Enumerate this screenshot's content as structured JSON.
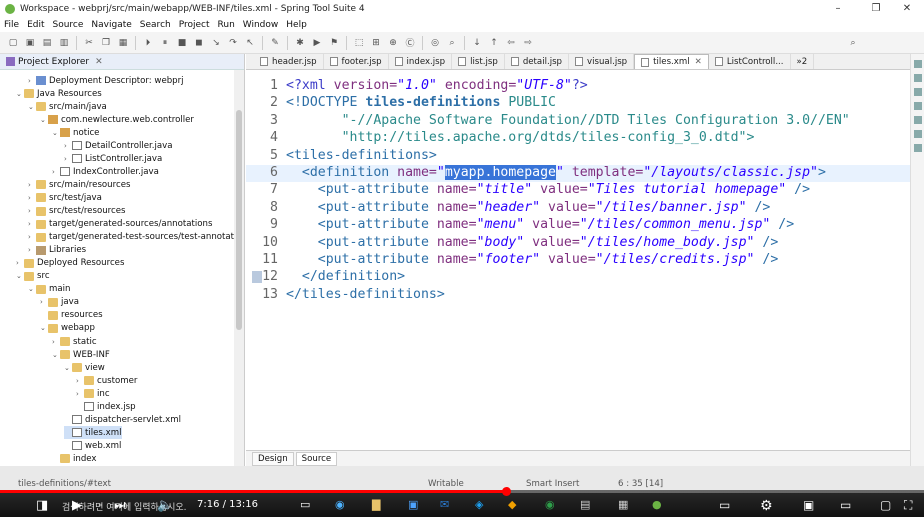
{
  "window": {
    "title": "Workspace - webprj/src/main/webapp/WEB-INF/tiles.xml - Spring Tool Suite 4"
  },
  "menu": [
    "File",
    "Edit",
    "Source",
    "Navigate",
    "Search",
    "Project",
    "Run",
    "Window",
    "Help"
  ],
  "explorer": {
    "title": "Project Explorer",
    "tree": [
      {
        "label": "Deployment Descriptor: webprj",
        "depth": 2,
        "icon": "descriptor",
        "arrow": ">"
      },
      {
        "label": "Java Resources",
        "depth": 1,
        "icon": "folder",
        "arrow": "v"
      },
      {
        "label": "src/main/java",
        "depth": 2,
        "icon": "folder",
        "arrow": "v"
      },
      {
        "label": "com.newlecture.web.controller",
        "depth": 3,
        "icon": "package",
        "arrow": "v"
      },
      {
        "label": "notice",
        "depth": 4,
        "icon": "package",
        "arrow": "v"
      },
      {
        "label": "DetailController.java",
        "depth": 5,
        "icon": "java",
        "arrow": ">"
      },
      {
        "label": "ListController.java",
        "depth": 5,
        "icon": "java",
        "arrow": ">"
      },
      {
        "label": "IndexController.java",
        "depth": 4,
        "icon": "java",
        "arrow": ">"
      },
      {
        "label": "src/main/resources",
        "depth": 2,
        "icon": "folder",
        "arrow": ">"
      },
      {
        "label": "src/test/java",
        "depth": 2,
        "icon": "folder",
        "arrow": ">"
      },
      {
        "label": "src/test/resources",
        "depth": 2,
        "icon": "folder",
        "arrow": ">"
      },
      {
        "label": "target/generated-sources/annotations",
        "depth": 2,
        "icon": "folder",
        "arrow": ">"
      },
      {
        "label": "target/generated-test-sources/test-annotation",
        "depth": 2,
        "icon": "folder",
        "arrow": ">"
      },
      {
        "label": "Libraries",
        "depth": 2,
        "icon": "library",
        "arrow": ">"
      },
      {
        "label": "Deployed Resources",
        "depth": 1,
        "icon": "folder",
        "arrow": ">"
      },
      {
        "label": "src",
        "depth": 1,
        "icon": "folder",
        "arrow": "v"
      },
      {
        "label": "main",
        "depth": 2,
        "icon": "folder",
        "arrow": "v"
      },
      {
        "label": "java",
        "depth": 3,
        "icon": "folder",
        "arrow": ">"
      },
      {
        "label": "resources",
        "depth": 3,
        "icon": "folder",
        "arrow": ""
      },
      {
        "label": "webapp",
        "depth": 3,
        "icon": "folder",
        "arrow": "v"
      },
      {
        "label": "static",
        "depth": 4,
        "icon": "folder",
        "arrow": ">"
      },
      {
        "label": "WEB-INF",
        "depth": 4,
        "icon": "folder",
        "arrow": "v"
      },
      {
        "label": "view",
        "depth": 5,
        "icon": "folder",
        "arrow": "v"
      },
      {
        "label": "customer",
        "depth": 6,
        "icon": "folder",
        "arrow": ">"
      },
      {
        "label": "inc",
        "depth": 6,
        "icon": "folder",
        "arrow": ">"
      },
      {
        "label": "index.jsp",
        "depth": 6,
        "icon": "file",
        "arrow": ""
      },
      {
        "label": "dispatcher-servlet.xml",
        "depth": 5,
        "icon": "xml",
        "arrow": ""
      },
      {
        "label": "tiles.xml",
        "depth": 5,
        "icon": "xml",
        "arrow": "",
        "selected": true
      },
      {
        "label": "web.xml",
        "depth": 5,
        "icon": "xml",
        "arrow": ""
      },
      {
        "label": "index",
        "depth": 4,
        "icon": "folder",
        "arrow": ""
      }
    ]
  },
  "tabs": [
    {
      "label": "header.jsp"
    },
    {
      "label": "footer.jsp"
    },
    {
      "label": "index.jsp"
    },
    {
      "label": "list.jsp"
    },
    {
      "label": "detail.jsp"
    },
    {
      "label": "visual.jsp"
    },
    {
      "label": "tiles.xml",
      "active": true
    },
    {
      "label": "ListControll..."
    },
    {
      "label": "»2"
    }
  ],
  "code": [
    {
      "n": "1",
      "parts": [
        [
          "pi",
          "<?xml "
        ],
        [
          "attr",
          "version="
        ],
        [
          "val",
          "\"1.0\""
        ],
        [
          "attr",
          " encoding="
        ],
        [
          "val",
          "\"UTF-8\""
        ],
        [
          "pi",
          "?>"
        ]
      ]
    },
    {
      "n": "2",
      "parts": [
        [
          "tag",
          "<!DOCTYPE "
        ],
        [
          "tagb",
          "tiles-definitions "
        ],
        [
          "doc",
          "PUBLIC"
        ]
      ]
    },
    {
      "n": "3",
      "parts": [
        [
          "doc",
          "       \"-//Apache Software Foundation//DTD Tiles Configuration 3.0//EN\""
        ]
      ]
    },
    {
      "n": "4",
      "parts": [
        [
          "doc",
          "       \"http://tiles.apache.org/dtds/tiles-config_3_0.dtd\">"
        ]
      ]
    },
    {
      "n": "5",
      "parts": [
        [
          "tag",
          "<tiles-definitions>"
        ]
      ]
    },
    {
      "n": "6",
      "parts": [
        [
          "tag",
          "  <definition "
        ],
        [
          "attr",
          "name="
        ],
        [
          "val",
          "\""
        ],
        [
          "sel",
          "myapp.homepage"
        ],
        [
          "val",
          "\""
        ],
        [
          "attr",
          " template="
        ],
        [
          "val",
          "\"/layouts/classic.jsp\""
        ],
        [
          "tag",
          ">"
        ]
      ],
      "current": true
    },
    {
      "n": "7",
      "parts": [
        [
          "tag",
          "    <put-attribute "
        ],
        [
          "attr",
          "name="
        ],
        [
          "val",
          "\"title\""
        ],
        [
          "attr",
          " value="
        ],
        [
          "val",
          "\"Tiles tutorial homepage\""
        ],
        [
          "tag",
          " />"
        ]
      ]
    },
    {
      "n": "8",
      "parts": [
        [
          "tag",
          "    <put-attribute "
        ],
        [
          "attr",
          "name="
        ],
        [
          "val",
          "\"header\""
        ],
        [
          "attr",
          " value="
        ],
        [
          "val",
          "\"/tiles/banner.jsp\""
        ],
        [
          "tag",
          " />"
        ]
      ]
    },
    {
      "n": "9",
      "parts": [
        [
          "tag",
          "    <put-attribute "
        ],
        [
          "attr",
          "name="
        ],
        [
          "val",
          "\"menu\""
        ],
        [
          "attr",
          " value="
        ],
        [
          "val",
          "\"/tiles/common_menu.jsp\""
        ],
        [
          "tag",
          " />"
        ]
      ]
    },
    {
      "n": "10",
      "parts": [
        [
          "tag",
          "    <put-attribute "
        ],
        [
          "attr",
          "name="
        ],
        [
          "val",
          "\"body\""
        ],
        [
          "attr",
          " value="
        ],
        [
          "val",
          "\"/tiles/home_body.jsp\""
        ],
        [
          "tag",
          " />"
        ]
      ]
    },
    {
      "n": "11",
      "parts": [
        [
          "tag",
          "    <put-attribute "
        ],
        [
          "attr",
          "name="
        ],
        [
          "val",
          "\"footer\""
        ],
        [
          "attr",
          " value="
        ],
        [
          "val",
          "\"/tiles/credits.jsp\""
        ],
        [
          "tag",
          " />"
        ]
      ]
    },
    {
      "n": "12",
      "parts": [
        [
          "tag",
          "  </definition>"
        ]
      ]
    },
    {
      "n": "13",
      "parts": [
        [
          "tag",
          "</tiles-definitions>"
        ]
      ]
    }
  ],
  "bottom_tabs": [
    {
      "label": "Design"
    },
    {
      "label": "Source",
      "active": true
    }
  ],
  "status": {
    "path": "tiles-definitions/#text",
    "writable": "Writable",
    "insert": "Smart Insert",
    "position": "6 : 35 [14]"
  },
  "video": {
    "time": "7:16 / 13:16",
    "progress": 0.548,
    "search_hint": "검색하려면 여기에 입력하십시오."
  },
  "colors": {
    "accent": "#3874d8",
    "progress": "#ff0000"
  }
}
